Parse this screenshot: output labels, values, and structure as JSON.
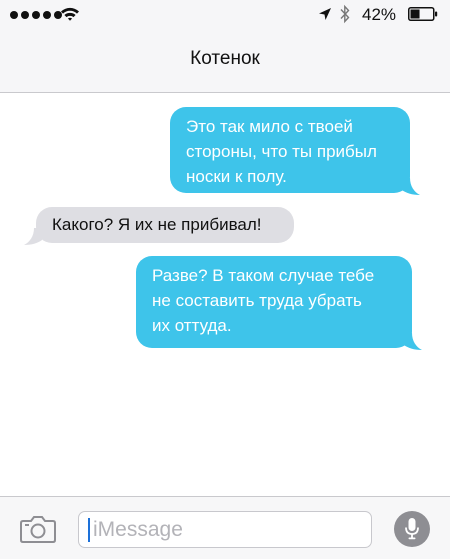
{
  "status_bar": {
    "signal_dots": 5,
    "battery_percent": "42%",
    "battery_level": 0.42,
    "icons": [
      "signal-dots",
      "wifi-icon",
      "location-icon",
      "bluetooth-icon",
      "battery-icon"
    ]
  },
  "nav": {
    "title": "Котенок"
  },
  "messages": [
    {
      "direction": "outgoing",
      "text": "Это так мило с твоей\nстороны, что ты прибыл\nноски к полу."
    },
    {
      "direction": "incoming",
      "text": "Какого? Я их не прибивал!"
    },
    {
      "direction": "outgoing",
      "text": "Разве? В таком случае тебе\nне составить труда убрать\nих оттуда."
    }
  ],
  "input_bar": {
    "placeholder": "iMessage",
    "value": "",
    "icons": [
      "camera-icon",
      "microphone-icon"
    ]
  },
  "colors": {
    "outgoing_bubble": "#3ec4ea",
    "incoming_bubble": "#dedee3",
    "header_bg": "#f6f6f8",
    "mic_button": "#8e8e93",
    "caret": "#1d71d9"
  }
}
